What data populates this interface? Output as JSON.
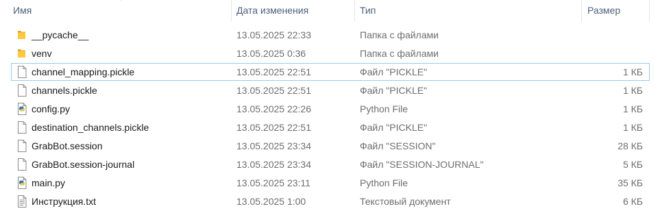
{
  "columns": {
    "name": "Имя",
    "date": "Дата изменения",
    "type": "Тип",
    "size": "Размер"
  },
  "files": [
    {
      "name": "__pycache__",
      "date": "13.05.2025 22:33",
      "type": "Папка с файлами",
      "size": "",
      "icon": "folder-icon"
    },
    {
      "name": "venv",
      "date": "13.05.2025 0:36",
      "type": "Папка с файлами",
      "size": "",
      "icon": "folder-icon"
    },
    {
      "name": "channel_mapping.pickle",
      "date": "13.05.2025 22:51",
      "type": "Файл \"PICKLE\"",
      "size": "1 КБ",
      "icon": "file-icon"
    },
    {
      "name": "channels.pickle",
      "date": "13.05.2025 22:51",
      "type": "Файл \"PICKLE\"",
      "size": "1 КБ",
      "icon": "file-icon"
    },
    {
      "name": "config.py",
      "date": "13.05.2025 22:26",
      "type": "Python File",
      "size": "1 КБ",
      "icon": "python-file-icon"
    },
    {
      "name": "destination_channels.pickle",
      "date": "13.05.2025 22:51",
      "type": "Файл \"PICKLE\"",
      "size": "1 КБ",
      "icon": "file-icon"
    },
    {
      "name": "GrabBot.session",
      "date": "13.05.2025 23:34",
      "type": "Файл \"SESSION\"",
      "size": "28 КБ",
      "icon": "file-icon"
    },
    {
      "name": "GrabBot.session-journal",
      "date": "13.05.2025 23:34",
      "type": "Файл \"SESSION-JOURNAL\"",
      "size": "5 КБ",
      "icon": "file-icon"
    },
    {
      "name": "main.py",
      "date": "13.05.2025 23:11",
      "type": "Python File",
      "size": "35 КБ",
      "icon": "python-file-icon"
    },
    {
      "name": "Инструкция.txt",
      "date": "13.05.2025 1:00",
      "type": "Текстовый документ",
      "size": "6 КБ",
      "icon": "text-file-icon"
    }
  ],
  "focused_row": 2,
  "sort": {
    "column": "name",
    "direction": "ascending"
  }
}
